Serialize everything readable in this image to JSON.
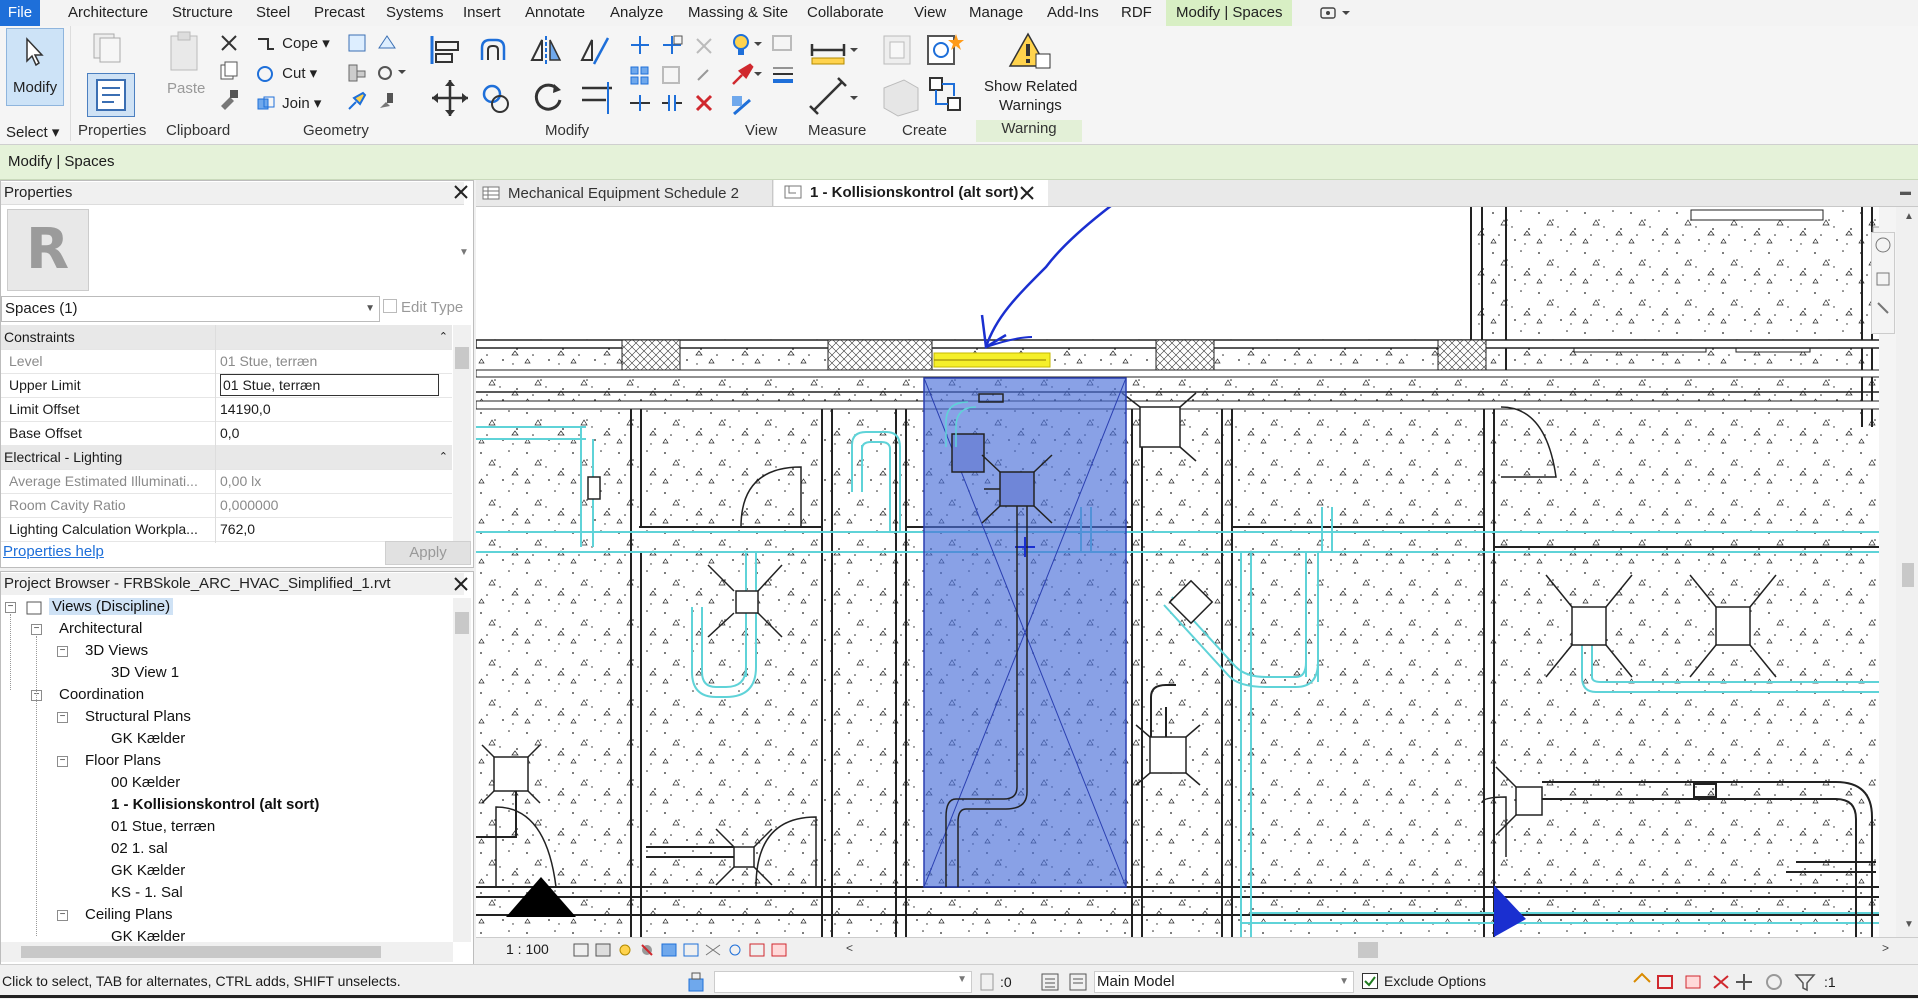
{
  "ribbon_tabs": [
    "File",
    "Architecture",
    "Structure",
    "Steel",
    "Precast",
    "Systems",
    "Insert",
    "Annotate",
    "Analyze",
    "Massing & Site",
    "Collaborate",
    "View",
    "Manage",
    "Add-Ins",
    "RDF",
    "Modify | Spaces"
  ],
  "ribbon": {
    "modify_label": "Modify",
    "select_label": "Select",
    "properties_label": "Properties",
    "paste_label": "Paste",
    "clipboard_label": "Clipboard",
    "cope_label": "Cope",
    "cut_label": "Cut",
    "join_label": "Join",
    "geometry_label": "Geometry",
    "modify_panel_label": "Modify",
    "view_label": "View",
    "measure_label": "Measure",
    "create_label": "Create",
    "show_related_line1": "Show Related",
    "show_related_line2": "Warnings",
    "warning_label": "Warning"
  },
  "context_bar": "Modify | Spaces",
  "properties": {
    "title": "Properties",
    "type_selector": "Spaces (1)",
    "edit_type": "Edit Type",
    "sections": {
      "constraints": "Constraints",
      "electrical": "Electrical - Lighting"
    },
    "rows": [
      {
        "key": "Level",
        "value": "01 Stue, terræn"
      },
      {
        "key": "Upper Limit",
        "value": "01 Stue, terræn"
      },
      {
        "key": "Limit Offset",
        "value": "14190,0"
      },
      {
        "key": "Base Offset",
        "value": "0,0"
      },
      {
        "key": "Average Estimated Illuminati...",
        "value": "0,00 lx"
      },
      {
        "key": "Room Cavity Ratio",
        "value": "0,000000"
      },
      {
        "key": "Lighting Calculation Workpla...",
        "value": "762,0"
      }
    ],
    "help_link": "Properties help",
    "apply": "Apply"
  },
  "project_browser": {
    "title": "Project Browser - FRBSkole_ARC_HVAC_Simplified_1.rvt",
    "items": [
      "Views (Discipline)",
      "Architectural",
      "3D Views",
      "3D View 1",
      "Coordination",
      "Structural Plans",
      "GK Kælder",
      "Floor Plans",
      "00 Kælder",
      "1 - Kollisionskontrol (alt sort)",
      "01 Stue, terræn",
      "02 1. sal",
      "GK Kælder",
      "KS - 1. Sal",
      "Ceiling Plans",
      "GK Kælder"
    ]
  },
  "view_tabs": [
    {
      "label": "Mechanical Equipment Schedule 2",
      "active": false
    },
    {
      "label": "1 - Kollisionskontrol (alt sort)",
      "active": true
    }
  ],
  "view_control": {
    "scale": "1 : 100"
  },
  "status": {
    "message": "Click to select, TAB for alternates, CTRL adds, SHIFT unselects.",
    "selection_count": ":0",
    "model": "Main Model",
    "exclude_options": "Exclude Options",
    "filter_count": ":1"
  },
  "colors": {
    "file_tab": "#1e6fd9",
    "context_tab": "#d8efc4",
    "space_fill": "#4a6fd8",
    "duct": "#5fd3d8",
    "highlight": "#f5ef2a",
    "annotation": "#1a2fd0"
  }
}
